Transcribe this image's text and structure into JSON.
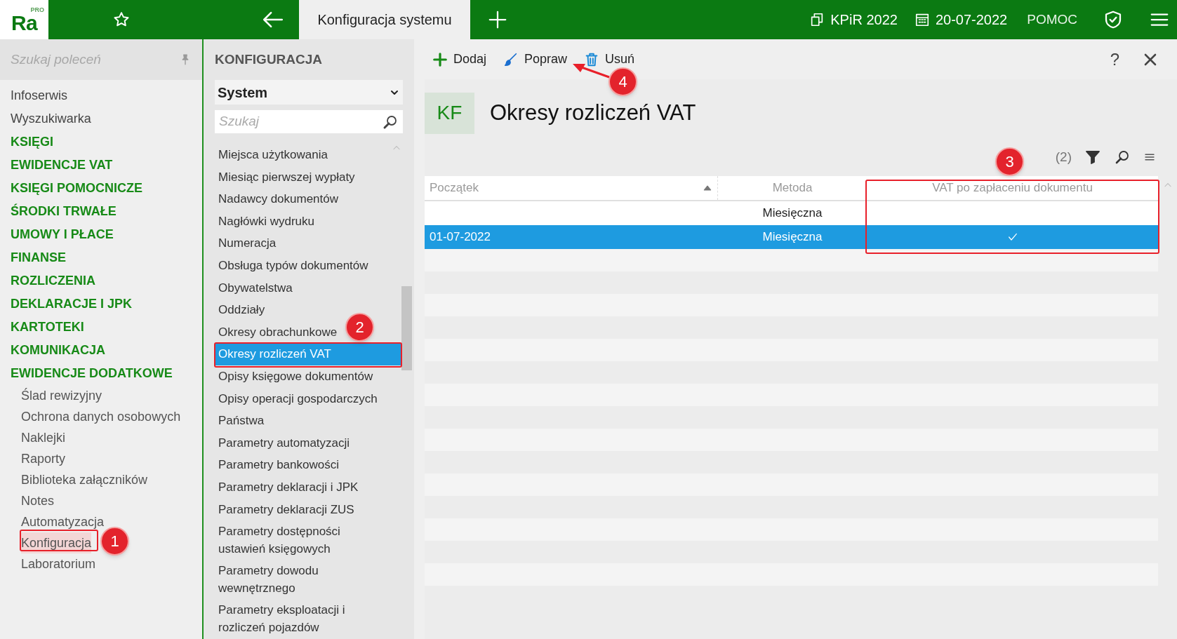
{
  "app": {
    "logo": "Ra",
    "logo_badge": "PRO"
  },
  "tabs": [
    {
      "label": "Konfiguracja systemu",
      "selected": true
    }
  ],
  "top_right": {
    "book": "KPiR 2022",
    "date": "20-07-2022",
    "help": "POMOC"
  },
  "sidebar": {
    "search_placeholder": "Szukaj poleceń",
    "items": [
      {
        "label": "Infoserwis",
        "kind": "link"
      },
      {
        "label": "Wyszukiwarka",
        "kind": "link"
      },
      {
        "label": "KSIĘGI",
        "kind": "section"
      },
      {
        "label": "EWIDENCJE VAT",
        "kind": "section"
      },
      {
        "label": "KSIĘGI POMOCNICZE",
        "kind": "section"
      },
      {
        "label": "ŚRODKI TRWAŁE",
        "kind": "section"
      },
      {
        "label": "UMOWY I PŁACE",
        "kind": "section"
      },
      {
        "label": "FINANSE",
        "kind": "section"
      },
      {
        "label": "ROZLICZENIA",
        "kind": "section"
      },
      {
        "label": "DEKLARACJE I JPK",
        "kind": "section"
      },
      {
        "label": "KARTOTEKI",
        "kind": "section"
      },
      {
        "label": "KOMUNIKACJA",
        "kind": "section"
      },
      {
        "label": "EWIDENCJE DODATKOWE",
        "kind": "section",
        "children": [
          {
            "label": "Ślad rewizyjny",
            "selected": false
          },
          {
            "label": "Ochrona danych osobowych",
            "selected": false
          },
          {
            "label": "Naklejki",
            "selected": false
          },
          {
            "label": "Raporty",
            "selected": false
          },
          {
            "label": "Biblioteka załączników",
            "selected": false
          },
          {
            "label": "Notes",
            "selected": false
          },
          {
            "label": "Automatyzacja",
            "selected": false
          },
          {
            "label": "Konfiguracja",
            "selected": true
          },
          {
            "label": "Laboratorium",
            "selected": false
          }
        ]
      }
    ]
  },
  "config_panel": {
    "title": "KONFIGURACJA",
    "dropdown": "System",
    "search_placeholder": "Szukaj",
    "items": [
      {
        "label": "Miejsca użytkowania",
        "selected": false
      },
      {
        "label": "Miesiąc pierwszej wypłaty",
        "selected": false
      },
      {
        "label": "Nadawcy dokumentów",
        "selected": false
      },
      {
        "label": "Nagłówki wydruku",
        "selected": false
      },
      {
        "label": "Numeracja",
        "selected": false
      },
      {
        "label": "Obsługa typów dokumentów",
        "selected": false
      },
      {
        "label": "Obywatelstwa",
        "selected": false
      },
      {
        "label": "Oddziały",
        "selected": false
      },
      {
        "label": "Okresy obrachunkowe",
        "selected": false
      },
      {
        "label": "Okresy rozliczeń VAT",
        "selected": true
      },
      {
        "label": "Opisy księgowe dokumentów",
        "selected": false
      },
      {
        "label": "Opisy operacji gospodarczych",
        "selected": false
      },
      {
        "label": "Państwa",
        "selected": false
      },
      {
        "label": "Parametry automatyzacji",
        "selected": false
      },
      {
        "label": "Parametry bankowości",
        "selected": false
      },
      {
        "label": "Parametry deklaracji i JPK",
        "selected": false
      },
      {
        "label": "Parametry deklaracji ZUS",
        "selected": false
      },
      {
        "label": "Parametry dostępności\nustawień księgowych",
        "selected": false
      },
      {
        "label": "Parametry dowodu\nwewnętrznego",
        "selected": false
      },
      {
        "label": "Parametry eksploatacji i\nrozliczeń pojazdów",
        "selected": false
      }
    ]
  },
  "toolbar": [
    {
      "label": "Dodaj",
      "kind": "add"
    },
    {
      "label": "Popraw",
      "kind": "edit"
    },
    {
      "label": "Usuń",
      "kind": "delete"
    }
  ],
  "help_button": "?",
  "header": {
    "badge": "KF",
    "title": "Okresy rozliczeń VAT"
  },
  "table": {
    "record_count": "(2)",
    "columns": [
      {
        "label": "Początek",
        "sorted": true
      },
      {
        "label": "Metoda",
        "sorted": false
      },
      {
        "label": "VAT po zapłaceniu dokumentu",
        "sorted": false
      }
    ],
    "rows": [
      {
        "method": "Miesięczna",
        "vat_after_payment": false,
        "selected": false
      },
      {
        "start": "01-07-2022",
        "method": "Miesięczna",
        "vat_after_payment": true,
        "selected": true
      }
    ]
  },
  "annotations": [
    "1",
    "2",
    "3",
    "4"
  ]
}
